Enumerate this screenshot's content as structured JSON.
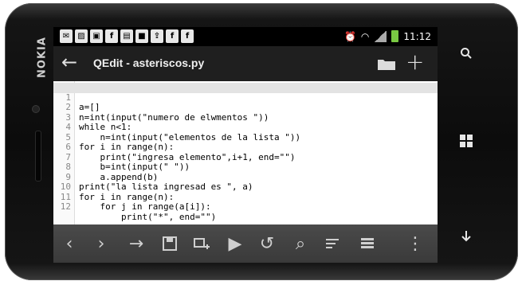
{
  "device": {
    "brand": "NOKIA"
  },
  "status_bar": {
    "notification_icons": [
      "mail-icon",
      "image-icon",
      "picture-icon",
      "facebook-icon",
      "sim-icon",
      "app-icon",
      "upload-icon",
      "facebook-icon",
      "facebook-icon"
    ],
    "time": "11:12"
  },
  "action_bar": {
    "title": "QEdit - asteriscos.py"
  },
  "editor": {
    "lines": [
      {
        "n": "1",
        "code": "a=[]"
      },
      {
        "n": "2",
        "code": "n=int(input(\"numero de elwmentos \"))"
      },
      {
        "n": "3",
        "code": "while n<1:"
      },
      {
        "n": "4",
        "code": "    n=int(input(\"elementos de la lista \"))"
      },
      {
        "n": "5",
        "code": "for i in range(n):"
      },
      {
        "n": "6",
        "code": "    print(\"ingresa elemento\",i+1, end=\"\")"
      },
      {
        "n": "7",
        "code": "    b=int(input(\" \"))"
      },
      {
        "n": "8",
        "code": "    a.append(b)"
      },
      {
        "n": "9",
        "code": "print(\"la lista ingresad es \", a)"
      },
      {
        "n": "10",
        "code": "for i in range(n):"
      },
      {
        "n": "11",
        "code": "    for j in range(a[i]):"
      },
      {
        "n": "12",
        "code": "        print(\"*\", end=\"\")"
      }
    ]
  },
  "toolbar": {
    "buttons": [
      "chevron-left-icon",
      "chevron-right-icon",
      "arrow-right-icon",
      "save-icon",
      "insert-icon",
      "play-icon",
      "undo-icon",
      "search-icon",
      "format-icon",
      "list-icon",
      "more-vertical-icon"
    ]
  },
  "hardware_buttons": [
    "search-icon",
    "windows-icon",
    "arrow-down-icon"
  ]
}
